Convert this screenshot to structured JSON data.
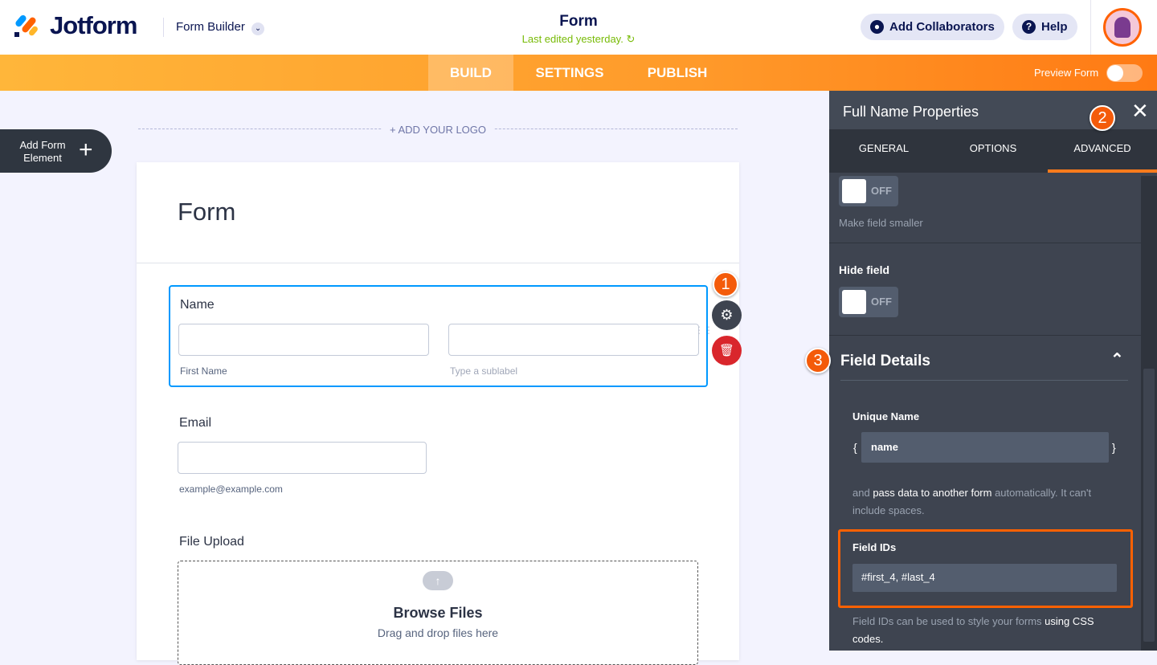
{
  "header": {
    "brand": "Jotform",
    "builder": "Form Builder",
    "title": "Form",
    "last_edited": "Last edited yesterday.",
    "add_collaborators": "Add Collaborators",
    "help": "Help"
  },
  "nav": {
    "tabs": [
      "BUILD",
      "SETTINGS",
      "PUBLISH"
    ],
    "active": "BUILD",
    "preview": "Preview Form"
  },
  "canvas": {
    "add_element": "Add Form Element",
    "add_logo": "+ ADD YOUR LOGO",
    "form_title": "Form",
    "fields": {
      "name_label": "Name",
      "first_sub": "First Name",
      "last_sub_placeholder": "Type a sublabel",
      "email_label": "Email",
      "email_sub": "example@example.com",
      "upload_label": "File Upload",
      "browse": "Browse Files",
      "drag": "Drag and drop files here"
    }
  },
  "panel": {
    "title": "Full Name Properties",
    "tabs": [
      "GENERAL",
      "OPTIONS",
      "ADVANCED"
    ],
    "active_tab": "ADVANCED",
    "off": "OFF",
    "make_smaller": "Make field smaller",
    "hide_field": "Hide field",
    "field_details": "Field Details",
    "unique_name": "Unique Name",
    "open_brace": "{",
    "close_brace": "}",
    "unique_value": "name",
    "desc1a": "and ",
    "desc1b": "pass data to another form",
    "desc1c": " automatically. It can't include spaces.",
    "field_ids": "Field IDs",
    "field_ids_value": "#first_4, #last_4",
    "desc2a": "Field IDs can be used to style your forms ",
    "desc2b": "using CSS codes."
  },
  "badges": [
    "1",
    "2",
    "3"
  ]
}
